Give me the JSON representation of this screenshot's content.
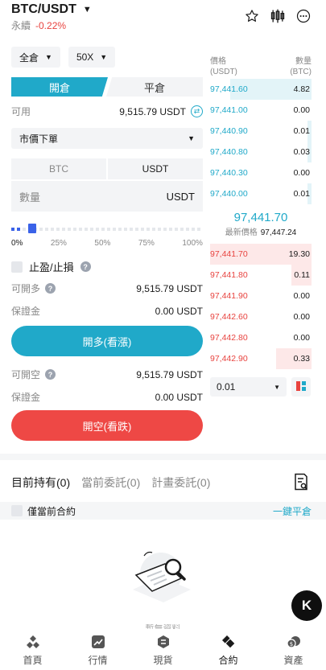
{
  "header": {
    "pair": "BTC/USDT",
    "pair_caret": "▼",
    "subtitle": "永續",
    "change": "-0.22%",
    "icons": [
      "star-icon",
      "candlestick-icon",
      "more-icon"
    ]
  },
  "form": {
    "margin_mode": "全倉",
    "leverage": "50X",
    "tab_open": "開倉",
    "tab_close": "平倉",
    "available_label": "可用",
    "available_value": "9,515.79 USDT",
    "order_type": "市價下單",
    "unit_btc": "BTC",
    "unit_usdt": "USDT",
    "qty_label": "數量",
    "qty_unit": "USDT",
    "slider_level": 0,
    "slider_ticks": [
      "0%",
      "25%",
      "50%",
      "75%",
      "100%"
    ],
    "tpsl_label": "止盈/止損",
    "long_avail_label": "可開多",
    "long_avail_value": "9,515.79 USDT",
    "long_margin_label": "保證金",
    "long_margin_value": "0.00 USDT",
    "long_button": "開多(看漲)",
    "short_avail_label": "可開空",
    "short_avail_value": "9,515.79 USDT",
    "short_margin_label": "保證金",
    "short_margin_value": "0.00 USDT",
    "short_button": "開空(看跌)"
  },
  "orderbook": {
    "price_header_1": "價格",
    "price_header_2": "(USDT)",
    "qty_header_1": "數量",
    "qty_header_2": "(BTC)",
    "bids": [
      {
        "price": "97,441.60",
        "qty": "4.82",
        "depth": 0.8
      },
      {
        "price": "97,441.00",
        "qty": "0.00",
        "depth": 0
      },
      {
        "price": "97,440.90",
        "qty": "0.01",
        "depth": 0.04
      },
      {
        "price": "97,440.80",
        "qty": "0.03",
        "depth": 0.04
      },
      {
        "price": "97,440.30",
        "qty": "0.00",
        "depth": 0
      },
      {
        "price": "97,440.00",
        "qty": "0.01",
        "depth": 0.04
      }
    ],
    "last_price": "97,441.70",
    "latest_label": "最新價格",
    "latest_value": "97,447.24",
    "asks": [
      {
        "price": "97,441.70",
        "qty": "19.30",
        "depth": 1.0
      },
      {
        "price": "97,441.80",
        "qty": "0.11",
        "depth": 0.2
      },
      {
        "price": "97,441.90",
        "qty": "0.00",
        "depth": 0
      },
      {
        "price": "97,442.60",
        "qty": "0.00",
        "depth": 0
      },
      {
        "price": "97,442.80",
        "qty": "0.00",
        "depth": 0
      },
      {
        "price": "97,442.90",
        "qty": "0.33",
        "depth": 0.35
      }
    ],
    "depth_value": "0.01",
    "colors": {
      "bid": "#20a9c9",
      "ask": "#e8433f"
    }
  },
  "positions": {
    "tabs": [
      "目前持有(0)",
      "當前委託(0)",
      "計畫委託(0)"
    ],
    "current_only": "僅當前合約",
    "close_all": "一鍵平倉",
    "empty_text": "暫無資料"
  },
  "fab": {
    "label": "K"
  },
  "bottom_nav": [
    {
      "label": "首頁",
      "icon": "home-icon"
    },
    {
      "label": "行情",
      "icon": "market-icon"
    },
    {
      "label": "現貨",
      "icon": "spot-icon"
    },
    {
      "label": "合約",
      "icon": "futures-icon"
    },
    {
      "label": "資產",
      "icon": "assets-icon"
    }
  ]
}
